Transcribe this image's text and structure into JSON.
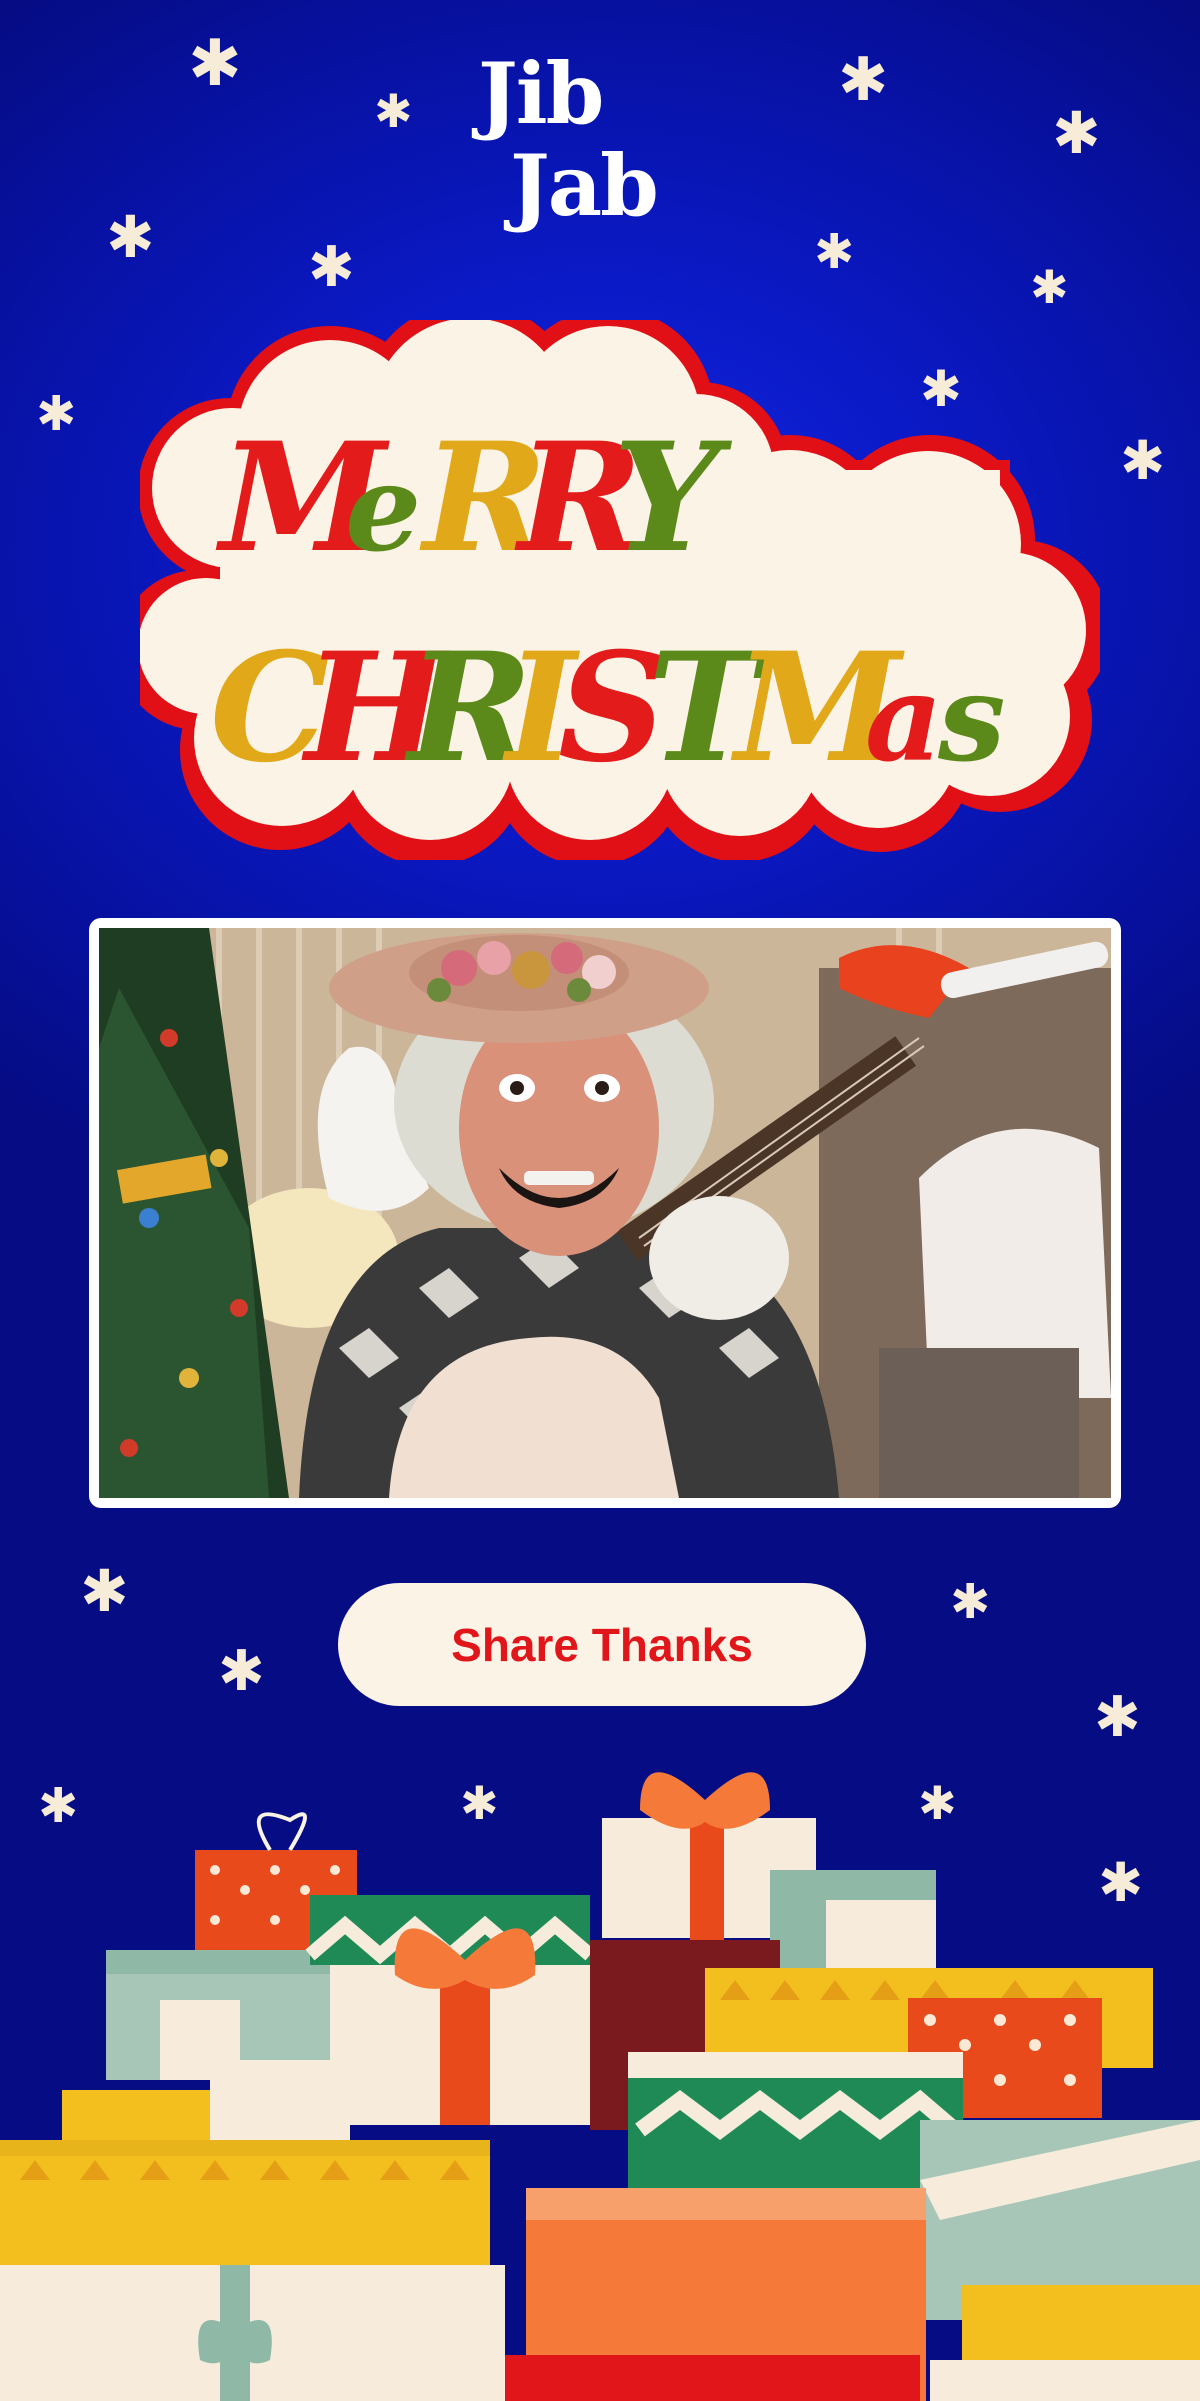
{
  "brand": {
    "logo_line1": "Jib",
    "logo_line2": "Jab"
  },
  "greeting": {
    "line1": [
      "M",
      "e",
      "R",
      "R",
      "Y"
    ],
    "line2": [
      "C",
      "H",
      "R",
      "I",
      "S",
      "T",
      "M",
      "a",
      "s"
    ],
    "colors": {
      "red": "#e31b1b",
      "green": "#5c8a1a",
      "gold": "#e1a91a",
      "cream": "#fbf3e6",
      "outline": "#e10f16"
    }
  },
  "photo": {
    "alt_label": "Personalized Christmas video still"
  },
  "cta": {
    "label": "Share Thanks"
  },
  "theme": {
    "background": "#0a19c4",
    "star_color": "#f7ecd7",
    "button_text": "#e0161b"
  },
  "icons": {
    "decor": "snowflake-star-icon",
    "gifts": "gift-pile-illustration"
  }
}
